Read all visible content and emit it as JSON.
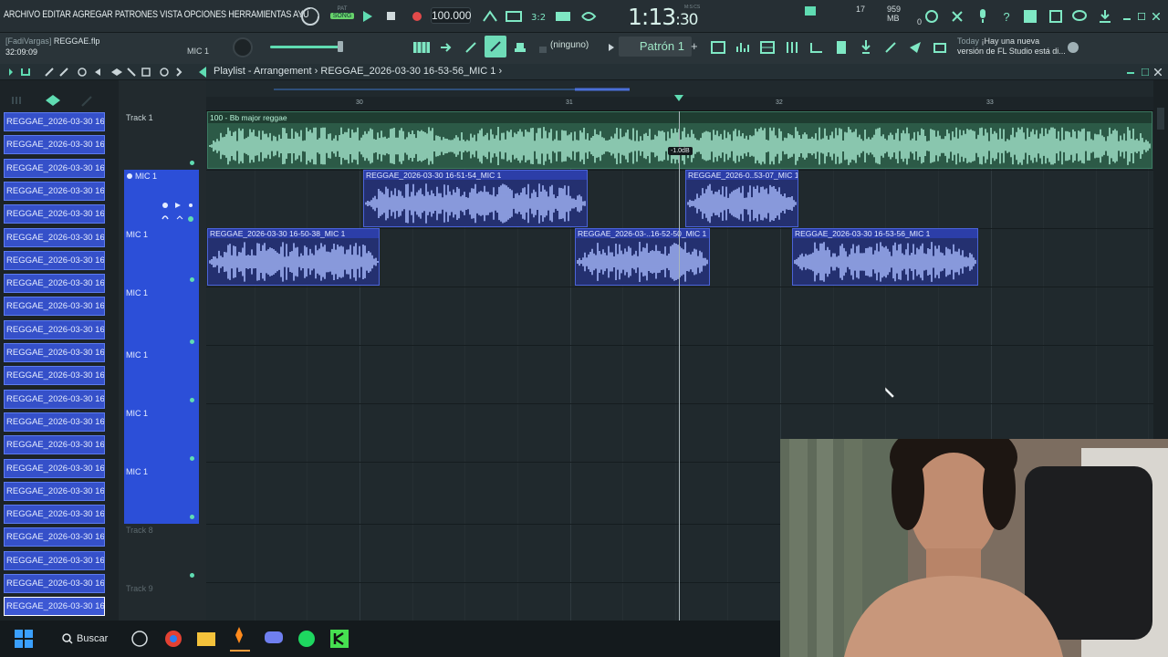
{
  "menu": {
    "items": "ARCHIVO EDITAR AGREGAR PATRONES VISTA OPCIONES HERRAMIENTAS AYU"
  },
  "transport": {
    "pat_label": "PAT",
    "song_label": "SONG",
    "tempo": "100.000",
    "time_main": "1:13",
    "time_small": ":30",
    "time_unit": "M:S:CS"
  },
  "monitor": {
    "cpu_value": "17",
    "memory": "959 MB",
    "polyphony": "0"
  },
  "project": {
    "user": "[FadiVargas]",
    "file": "REGGAE.flp",
    "time": "32:09:09",
    "mixer_track": "MIC 1"
  },
  "toolbar2": {
    "snap": "(ninguno)",
    "pattern": "Patrón 1",
    "add": "+"
  },
  "news": {
    "today": "Today",
    "line1": "¡Hay una nueva",
    "line2": "versión de FL Studio está di..."
  },
  "playlist": {
    "title": "Playlist - Arrangement",
    "separator": "›",
    "current": "REGGAE_2026-03-30 16-53-56_MIC 1"
  },
  "picker": {
    "items": [
      "REGGAE_2026-03-30 16-...",
      "REGGAE_2026-03-30 16-...",
      "REGGAE_2026-03-30 16-...",
      "REGGAE_2026-03-30 16-...",
      "REGGAE_2026-03-30 16-...",
      "REGGAE_2026-03-30 16-...",
      "REGGAE_2026-03-30 16-...",
      "REGGAE_2026-03-30 16-...",
      "REGGAE_2026-03-30 16-...",
      "REGGAE_2026-03-30 16-...",
      "REGGAE_2026-03-30 16-...",
      "REGGAE_2026-03-30 16-...",
      "REGGAE_2026-03-30 16-...",
      "REGGAE_2026-03-30 16-...",
      "REGGAE_2026-03-30 16-...",
      "REGGAE_2026-03-30 16-...",
      "REGGAE_2026-03-30 16-...",
      "REGGAE_2026-03-30 16-...",
      "REGGAE_2026-03-30 16-...",
      "REGGAE_2026-03-30 16-...",
      "REGGAE_2026-03-30 16-...",
      "REGGAE_2026-03-30 16-..."
    ]
  },
  "tracks": [
    {
      "name": "Track 1"
    },
    {
      "name": "MIC 1"
    },
    {
      "name": "MIC 1"
    },
    {
      "name": "MIC 1"
    },
    {
      "name": "MIC 1"
    },
    {
      "name": "MIC 1"
    },
    {
      "name": "MIC 1"
    },
    {
      "name": "Track 8"
    },
    {
      "name": "Track 9"
    }
  ],
  "ruler": {
    "bars": [
      "30",
      "31",
      "32",
      "33"
    ]
  },
  "clips": {
    "beat": "100 - Bb major reggae",
    "c1": "REGGAE_2026-03-30 16-51-54_MIC 1",
    "c2": "REGGAE_2026-0..53-07_MIC 1",
    "c3": "REGGAE_2026-03-30 16-50-38_MIC 1",
    "c4": "REGGAE_2026-03-..16-52-50_MIC 1",
    "c5": "REGGAE_2026-03-30 16-53-56_MIC 1"
  },
  "volume_hint": "-1.0dB",
  "taskbar": {
    "search": "Buscar"
  },
  "colors": {
    "accent": "#5fdcb2",
    "clip_blue": "#3550c9",
    "track_blue": "#2c4fd8",
    "beat_green": "#2c5a47"
  }
}
